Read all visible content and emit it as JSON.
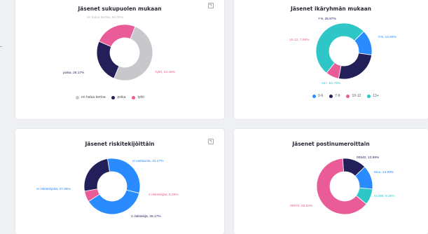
{
  "colors": {
    "grey": "#c8c8cc",
    "navy": "#221f59",
    "pink": "#e95c98",
    "blue": "#2a8bff",
    "teal": "#2ec6c6"
  },
  "chart_data": [
    {
      "type": "pie",
      "title": "Jäsenet sukupuolen mukaan",
      "labels": [
        "en halua kertoa",
        "poika",
        "tyttö"
      ],
      "values": [
        50.0,
        25.17,
        24.48
      ],
      "point_labels": [
        "en halua kertoa, 50.00%",
        "poika, 25.17%",
        "tyttö, 24.48%"
      ],
      "colors": [
        "#c8c8cc",
        "#221f59",
        "#e95c98"
      ],
      "legend": [
        "en halua kertoa",
        "poika",
        "tyttö"
      ]
    },
    {
      "type": "pie",
      "title": "Jäsenet ikäryhmän mukaan",
      "labels": [
        "0-6",
        "7-9",
        "10-12",
        "13+"
      ],
      "values": [
        14.69,
        25.87,
        7.69,
        51.75
      ],
      "point_labels": [
        "0-6, 14.69%",
        "7-9, 25.87%",
        "10-12, 7.69%",
        "13+, 51.75%"
      ],
      "colors": [
        "#2a8bff",
        "#221f59",
        "#e95c98",
        "#2ec6c6"
      ],
      "legend": [
        "0-6",
        "7-9",
        "10-12",
        "13+"
      ]
    },
    {
      "type": "pie",
      "title": "Jäsenet riskitekijöittäin",
      "labels": [
        "ei riskitekijöitä",
        "2 riskitekijää",
        "1 riskitekijä",
        "ei vastausta"
      ],
      "values": [
        37.06,
        6.29,
        25.17,
        31.47
      ],
      "point_labels": [
        "ei riskitekijöitä, 37.06%",
        "2 riskitekijää, 6.29%",
        "1 riskitekijä, 25.17%",
        "ei vastausta, 31.47%"
      ],
      "colors": [
        "#2a8bff",
        "#e95c98",
        "#221f59",
        "#2a8bff"
      ]
    },
    {
      "type": "pie",
      "title": "Jäsenet postinumeroittain",
      "labels": [
        "00540",
        "Muu",
        "01280",
        "00970"
      ],
      "values": [
        13.99,
        13.99,
        9.35,
        63.64
      ],
      "point_labels": [
        "00540, 13.99%",
        "Muu, 13.99%",
        "01280, 9.35%",
        "00970, 63.64%"
      ],
      "colors": [
        "#221f59",
        "#2a8bff",
        "#2ec6c6",
        "#e95c98"
      ]
    }
  ]
}
